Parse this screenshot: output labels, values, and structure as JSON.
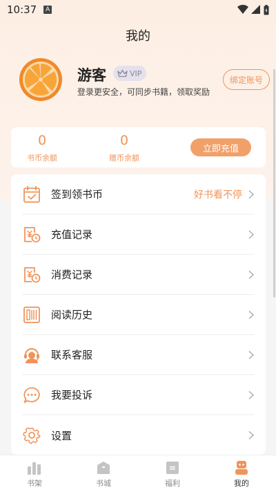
{
  "status_bar": {
    "time": "10:37",
    "notification_icon": "A"
  },
  "header": {
    "title": "我的"
  },
  "profile": {
    "username": "游客",
    "vip_label": "VIP",
    "login_hint": "登录更安全，可同步书籍，领取奖励",
    "bind_button": "绑定账号"
  },
  "balance": {
    "book_coin_value": "0",
    "book_coin_label": "书币余额",
    "gift_coin_value": "0",
    "gift_coin_label": "赠币余额",
    "recharge_button": "立即充值"
  },
  "menu": {
    "items": [
      {
        "label": "签到领书币",
        "extra": "好书看不停",
        "icon": "calendar-check-icon"
      },
      {
        "label": "充值记录",
        "icon": "receipt-clock-icon"
      },
      {
        "label": "消费记录",
        "icon": "receipt-clock-icon"
      },
      {
        "label": "阅读历史",
        "icon": "book-history-icon"
      },
      {
        "label": "联系客服",
        "icon": "customer-service-icon"
      },
      {
        "label": "我要投诉",
        "icon": "chat-bubble-icon"
      },
      {
        "label": "设置",
        "icon": "gear-icon"
      }
    ]
  },
  "tabs": [
    {
      "label": "书架",
      "icon": "bookshelf-icon"
    },
    {
      "label": "书城",
      "icon": "bookstore-icon"
    },
    {
      "label": "福利",
      "icon": "gift-icon"
    },
    {
      "label": "我的",
      "icon": "profile-icon",
      "active": true
    }
  ],
  "colors": {
    "accent": "#f0945a",
    "header_bg": "#fdeee3",
    "page_bg": "#f5f5f5",
    "vip_bg": "#e4e1ec"
  }
}
